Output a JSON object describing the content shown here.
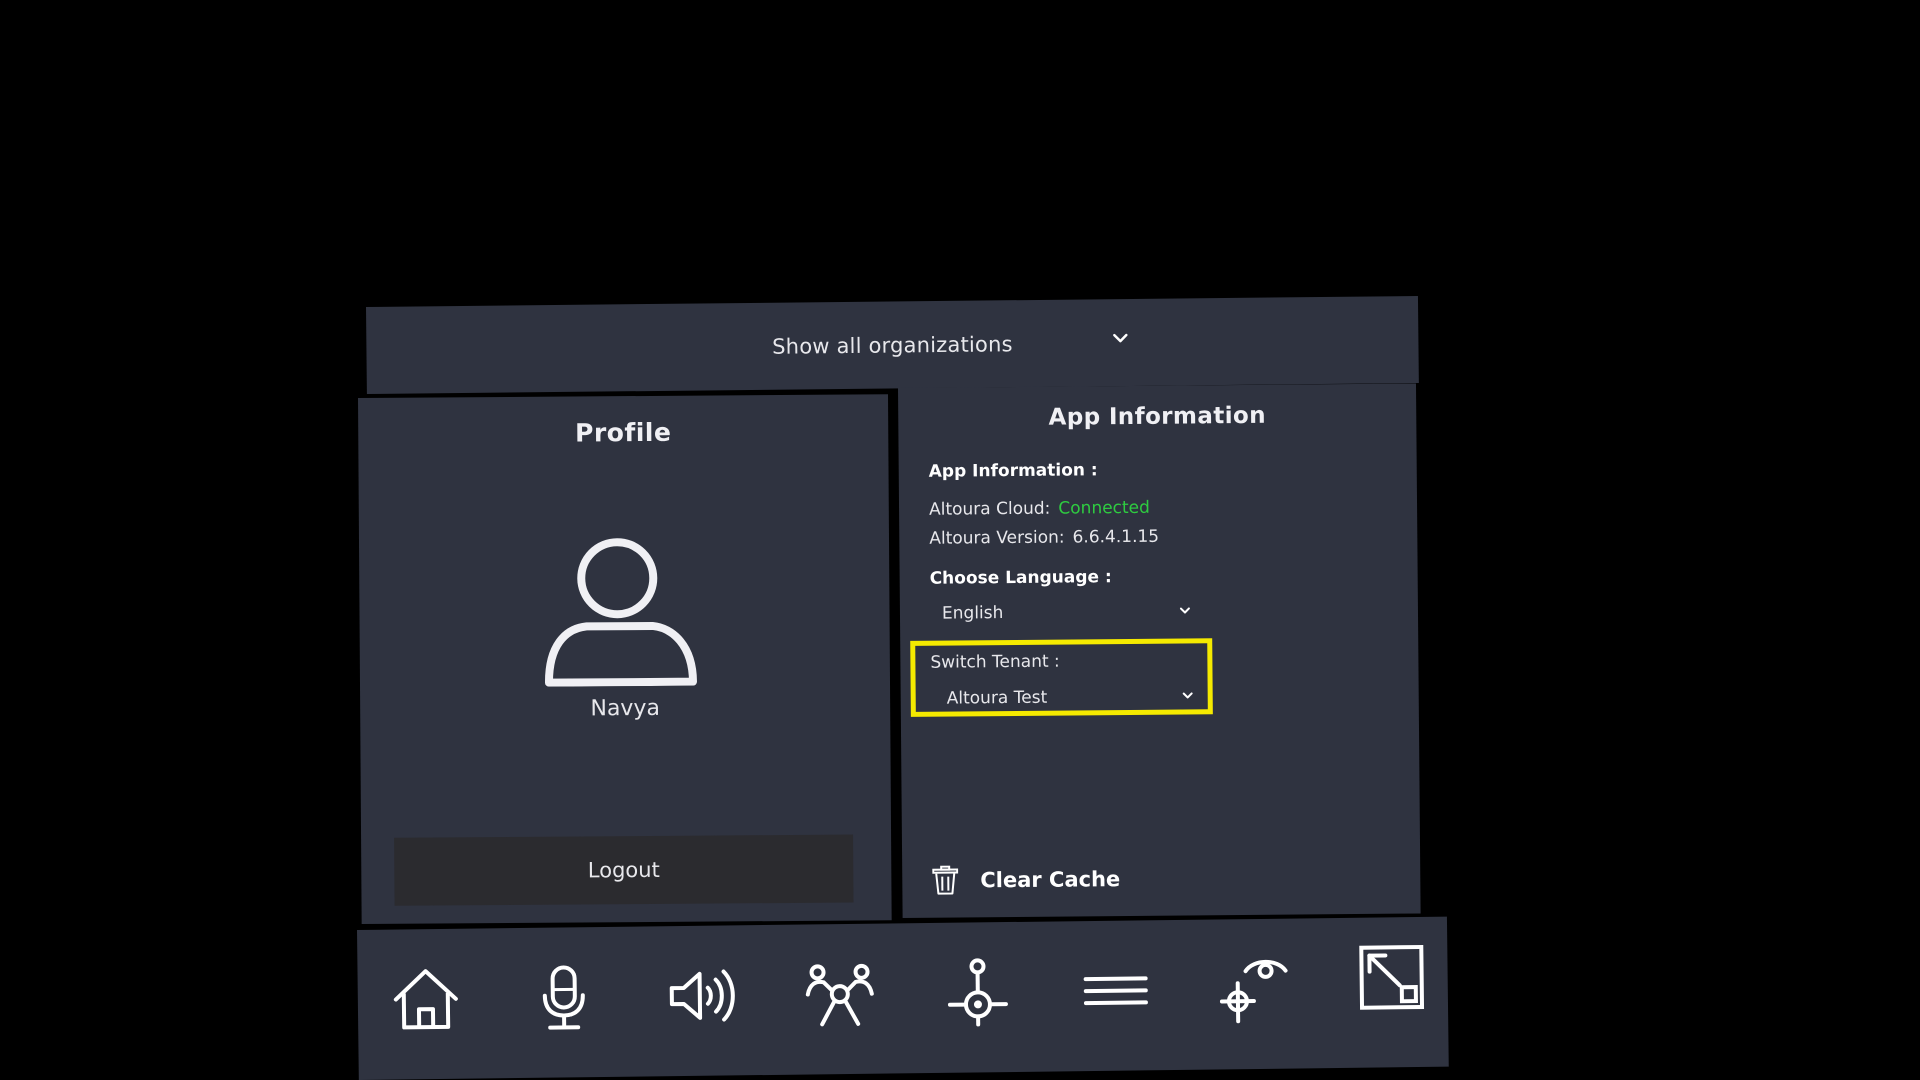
{
  "header": {
    "organizations_label": "Show all organizations"
  },
  "profile": {
    "title": "Profile",
    "user_name": "Navya",
    "logout_label": "Logout"
  },
  "app_info": {
    "title": "App Information",
    "section_label": "App Information :",
    "cloud_label": "Altoura Cloud:",
    "cloud_status": "Connected",
    "version_label": "Altoura Version:",
    "version_value": "6.6.4.1.15",
    "language_label": "Choose Language :",
    "language_value": "English",
    "tenant_label": "Switch Tenant :",
    "tenant_value": "Altoura Test",
    "clear_cache_label": "Clear Cache"
  },
  "toolbar": {
    "items": [
      "home-icon",
      "microphone-icon",
      "speaker-icon",
      "users-group-icon",
      "joystick-icon",
      "menu-icon",
      "spectate-icon",
      "expand-icon"
    ]
  },
  "colors": {
    "background": "#000000",
    "panel": "#2f3340",
    "button_dark": "#2b2b2f",
    "connected_green": "#2ecc40",
    "highlight_yellow": "#f5ea00"
  }
}
